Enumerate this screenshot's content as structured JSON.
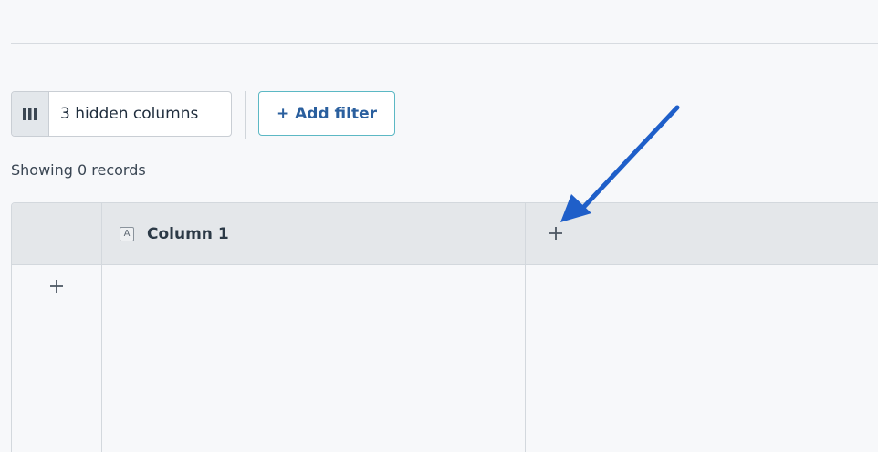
{
  "toolbar": {
    "hidden_columns_label": "3 hidden columns",
    "add_filter_label": "+ Add filter"
  },
  "status": {
    "records_text": "Showing 0 records"
  },
  "grid": {
    "columns": [
      {
        "type_icon_letter": "A",
        "title": "Column 1"
      }
    ]
  },
  "colors": {
    "accent_border": "#5cb8c4",
    "accent_text": "#2a5f9e",
    "annotation_arrow": "#1f5fc9"
  }
}
